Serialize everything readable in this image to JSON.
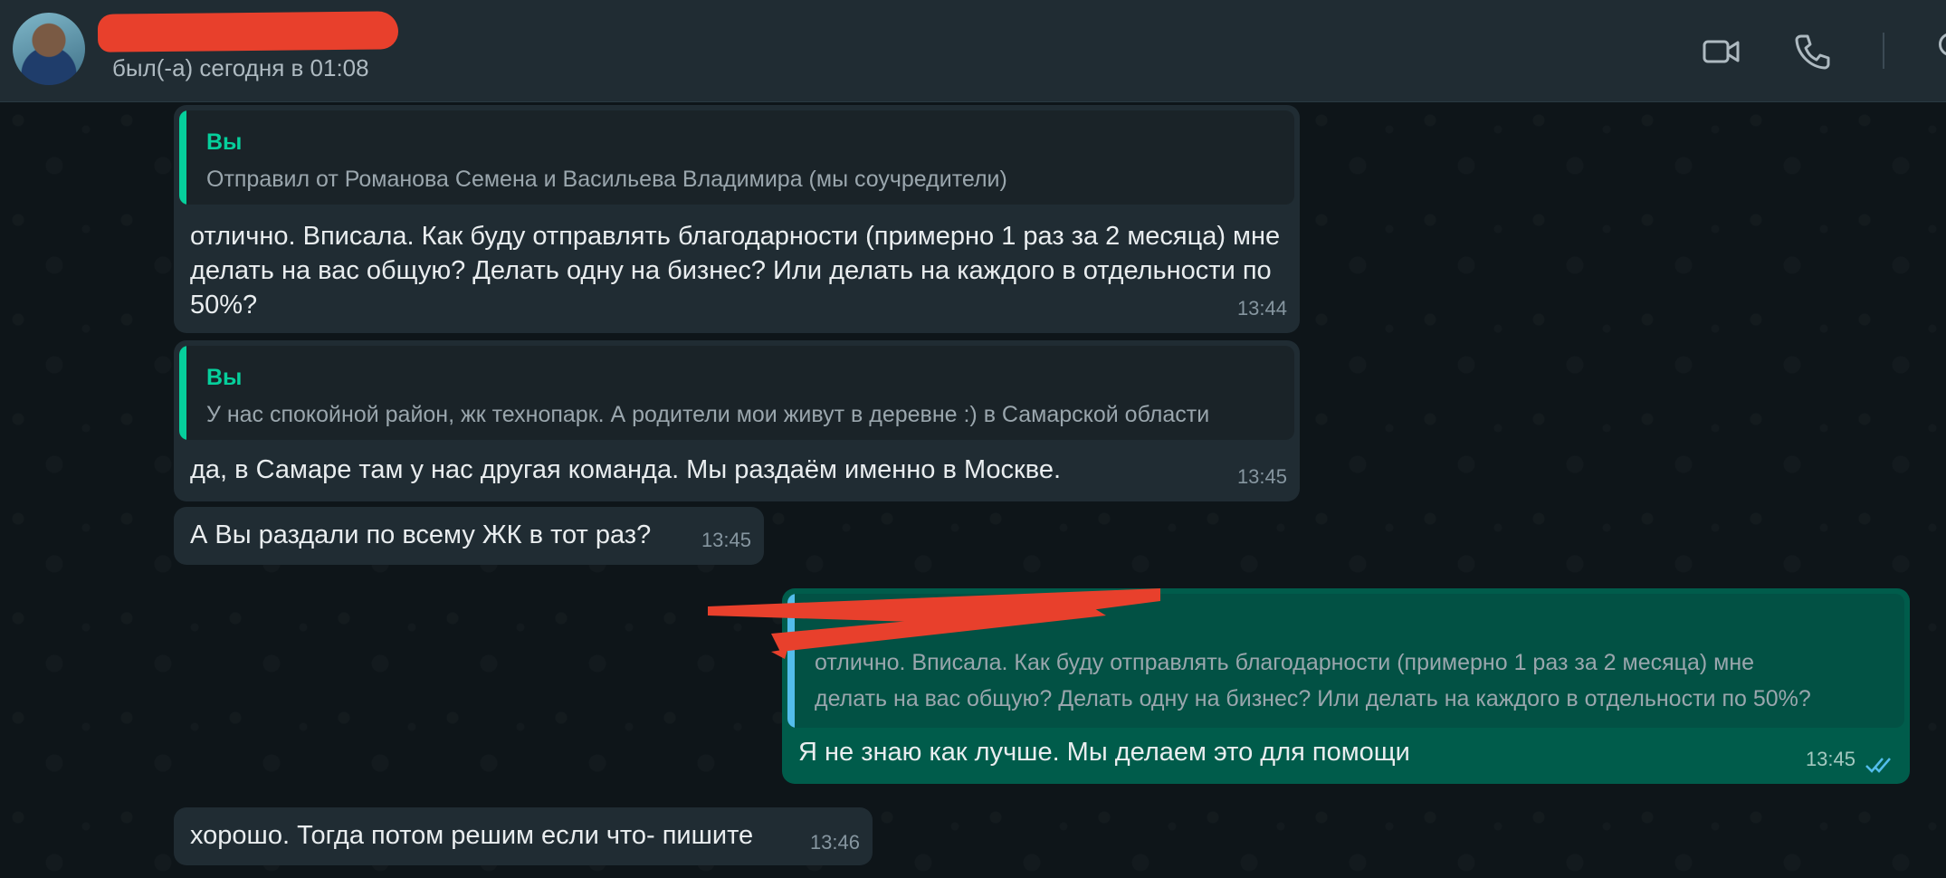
{
  "header": {
    "contact_name": "",
    "status": "был(-а) сегодня в 01:08",
    "icons": [
      "video-call-icon",
      "voice-call-icon",
      "search-icon"
    ]
  },
  "messages": [
    {
      "direction": "in",
      "quote_author": "Вы",
      "quote_text": "Отправил от Романова Семена и Васильева Владимира (мы соучредители)",
      "lines": [
        "отлично. Вписала. Как буду отправлять благодарности (примерно 1 раз за 2 месяца) мне",
        "делать на вас общую? Делать одну на бизнес? Или делать на каждого в отдельности по",
        "50%?"
      ],
      "time": "13:44"
    },
    {
      "direction": "in",
      "quote_author": "Вы",
      "quote_text": "У нас спокойной район, жк технопарк. А родители мои живут в деревне :) в Самарской области",
      "lines": [
        "да, в Самаре там у нас другая команда. Мы раздаём именно в Москве."
      ],
      "time": "13:45"
    },
    {
      "direction": "in",
      "lines": [
        "А Вы раздали по всему ЖК в тот раз?"
      ],
      "time": "13:45"
    },
    {
      "direction": "out",
      "quote_author": "",
      "quote_lines": [
        "отлично. Вписала. Как буду отправлять благодарности (примерно 1 раз за 2 месяца) мне",
        "делать на вас общую? Делать одну на бизнес? Или делать на каждого в отдельности по 50%?"
      ],
      "lines": [
        "Я не знаю как лучше. Мы делаем это для помощи"
      ],
      "time": "13:45",
      "read": true
    },
    {
      "direction": "in",
      "lines": [
        "хорошо. Тогда потом решим если что- пишите"
      ],
      "time": "13:46"
    }
  ],
  "colors": {
    "header_bg": "#202c33",
    "incoming_bubble": "#202c33",
    "outgoing_bubble": "#005c4b",
    "quote_author": "#06cf9c",
    "redaction": "#e8402c",
    "read_ticks": "#53bdeb"
  }
}
